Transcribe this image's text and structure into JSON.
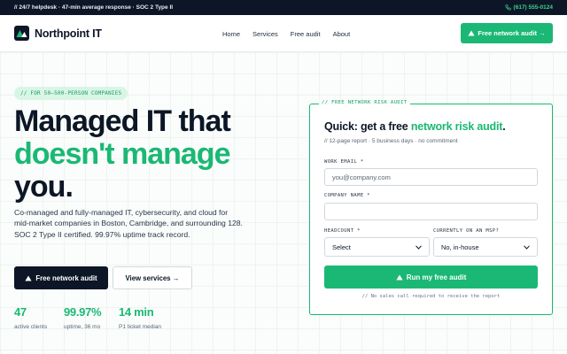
{
  "topbar": {
    "left_text": "// 24/7 helpdesk · 47-min average response · SOC 2 Type II",
    "phone_icon": "phone-icon",
    "phone": "(617) 555-0124"
  },
  "header": {
    "brand": "Northpoint IT",
    "logo_icon": "mountain-logo-icon",
    "nav": [
      "Home",
      "Services",
      "Free audit",
      "About"
    ],
    "cta": "Free network audit →",
    "cta_icon": "warning-triangle-icon"
  },
  "hero": {
    "pill": "// FOR 50–500-PERSON COMPANIES",
    "title_line1": "Managed IT that",
    "title_line2": "doesn't manage",
    "title_line3": "you.",
    "lead": "Co-managed and fully-managed IT, cybersecurity, and cloud for mid-market companies in Boston, Cambridge, and surrounding 128. SOC 2 Type II certified. 99.97% uptime track record.",
    "primary_button": "Free network audit",
    "secondary_button": "View services →",
    "stats": [
      {
        "value": "47",
        "label": "active clients"
      },
      {
        "value": "99.97%",
        "label": "uptime, 36 mo"
      },
      {
        "value": "14 min",
        "label": "P1 ticket median"
      }
    ]
  },
  "form": {
    "tag": "// FREE NETWORK RISK AUDIT",
    "title_prefix": "Quick: get a free ",
    "title_highlight": "network risk audit",
    "title_suffix": ".",
    "subtitle": "// 12-page report · 5 business days · no commitment",
    "email_label": "WORK EMAIL *",
    "email_placeholder": "you@company.com",
    "company_label": "COMPANY NAME *",
    "company_placeholder": "",
    "headcount_label": "HEADCOUNT *",
    "headcount_value": "Select",
    "msp_label": "CURRENTLY ON AN MSP?",
    "msp_value": "No, in-house",
    "submit": "Run my free audit",
    "note": "// No sales call required to receive the report"
  },
  "colors": {
    "accent": "#1ab874",
    "navy": "#0c1626",
    "pill_bg": "#d9f5e6"
  }
}
